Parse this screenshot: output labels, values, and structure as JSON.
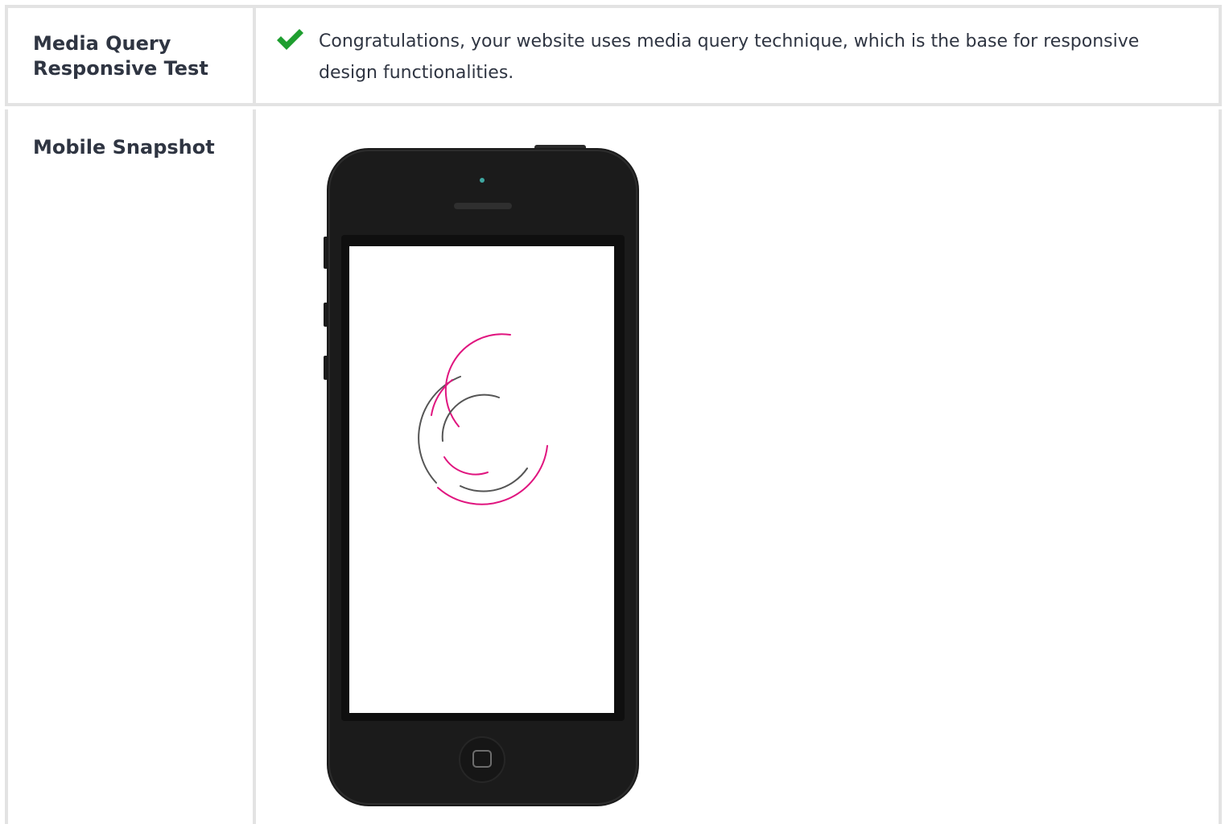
{
  "rows": [
    {
      "label": "Media Query Responsive Test",
      "status_icon": "check-icon",
      "status_color": "#1e9e2f",
      "message": "Congratulations, your website uses media query technique, which is the base for responsive design functionalities."
    },
    {
      "label": "Mobile Snapshot",
      "snapshot": {
        "device": "phone",
        "screen_content": "loading-spinner-icon",
        "spinner_colors": [
          "#e0157f",
          "#555555"
        ]
      }
    }
  ],
  "colors": {
    "border": "#e3e3e3",
    "text": "#2f3542",
    "phone_body": "#1b1b1b"
  }
}
